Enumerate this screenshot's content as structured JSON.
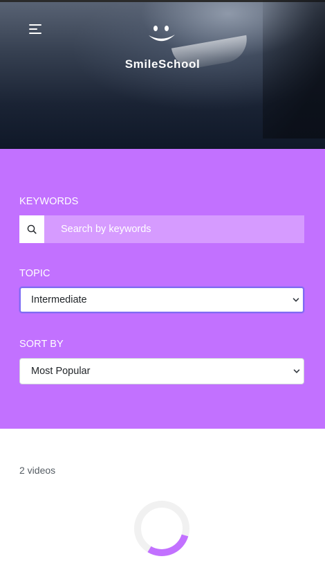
{
  "header": {
    "brand": "SmileSchool",
    "menu_icon": "hamburger-icon",
    "logo_icon": "smile-face-icon"
  },
  "filters": {
    "keywords": {
      "label": "KEYWORDS",
      "placeholder": "Search by keywords",
      "value": "",
      "icon": "search-icon"
    },
    "topic": {
      "label": "TOPIC",
      "selected": "Intermediate"
    },
    "sort_by": {
      "label": "SORT BY",
      "selected": "Most Popular"
    }
  },
  "results": {
    "count_text": "2 videos",
    "loading": true
  },
  "colors": {
    "filter_bg": "#c271ff",
    "search_input_bg": "#d69bff",
    "spinner_accent": "#c271ff",
    "focus_ring": "#7f6cf3"
  }
}
